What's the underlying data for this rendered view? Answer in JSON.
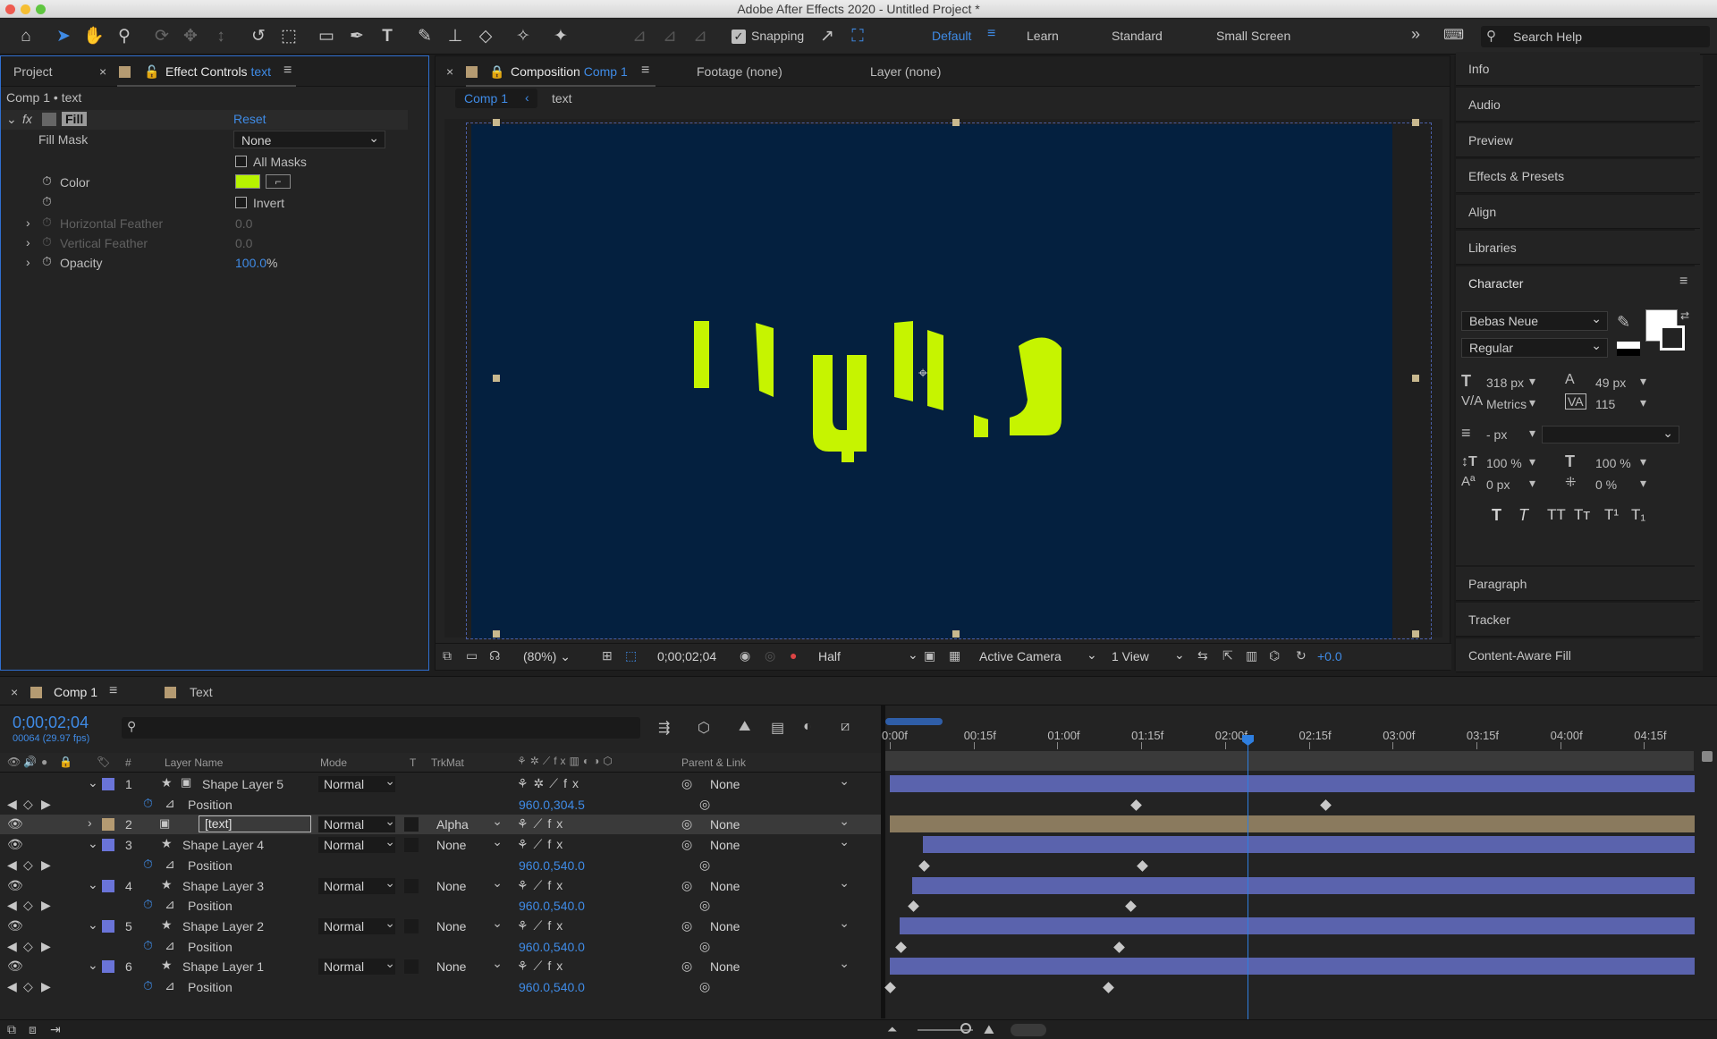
{
  "app": {
    "title": "Adobe After Effects 2020 - Untitled Project *"
  },
  "toolbar": {
    "snapping_label": "Snapping",
    "workspaces": [
      "Default",
      "Learn",
      "Standard",
      "Small Screen"
    ],
    "search_placeholder": "Search Help"
  },
  "effect_controls": {
    "tabs": {
      "project": "Project",
      "effect_controls": "Effect Controls",
      "effect_target": "text"
    },
    "breadcrumb": "Comp 1 • text",
    "effect_name": "Fill",
    "reset_label": "Reset",
    "fill_mask_label": "Fill Mask",
    "fill_mask_value": "None",
    "all_masks_label": "All Masks",
    "color_label": "Color",
    "color_value": "#b7f200",
    "invert_label": "Invert",
    "h_feather_label": "Horizontal Feather",
    "h_feather_value": "0.0",
    "v_feather_label": "Vertical Feather",
    "v_feather_value": "0.0",
    "opacity_label": "Opacity",
    "opacity_value": "100.0",
    "opacity_unit": "%"
  },
  "composition": {
    "tabs": {
      "composition": "Composition",
      "comp_name": "Comp 1",
      "footage": "Footage (none)",
      "layer": "Layer (none)"
    },
    "breadcrumb": [
      "Comp 1",
      "text"
    ],
    "background_color": "#04203f",
    "text_color": "#c6f400",
    "footer": {
      "zoom": "(80%)",
      "timecode": "0;00;02;04",
      "resolution": "Half",
      "camera": "Active Camera",
      "views": "1 View",
      "exposure": "+0.0"
    }
  },
  "right_panels": {
    "items_top": [
      "Info",
      "Audio",
      "Preview",
      "Effects & Presets",
      "Align",
      "Libraries"
    ],
    "character": {
      "title": "Character",
      "font": "Bebas Neue",
      "style": "Regular",
      "size": "318 px",
      "leading": "49 px",
      "kerning": "Metrics",
      "tracking": "115",
      "stroke": "- px",
      "v_scale": "100 %",
      "h_scale": "100 %",
      "baseline": "0 px",
      "tsume": "0 %"
    },
    "items_bottom": [
      "Paragraph",
      "Tracker",
      "Content-Aware Fill"
    ]
  },
  "timeline": {
    "tabs": [
      "Comp 1",
      "Text"
    ],
    "timecode": "0;00;02;04",
    "frames": "00064 (29.97 fps)",
    "headers": {
      "num": "#",
      "layer_name": "Layer Name",
      "mode": "Mode",
      "t": "T",
      "trkmat": "TrkMat",
      "parent": "Parent & Link"
    },
    "ruler": [
      "0:00f",
      "00:15f",
      "01:00f",
      "01:15f",
      "02:00f",
      "02:15f",
      "03:00f",
      "03:15f",
      "04:00f",
      "04:15f"
    ],
    "layers": [
      {
        "num": "1",
        "name": "Shape Layer 5",
        "mode": "Normal",
        "trkmat": "",
        "parent": "None",
        "prop": "Position",
        "value": "960.0,304.5"
      },
      {
        "num": "2",
        "name": "[text]",
        "mode": "Normal",
        "trkmat": "Alpha",
        "parent": "None"
      },
      {
        "num": "3",
        "name": "Shape Layer 4",
        "mode": "Normal",
        "trkmat": "None",
        "parent": "None",
        "prop": "Position",
        "value": "960.0,540.0"
      },
      {
        "num": "4",
        "name": "Shape Layer 3",
        "mode": "Normal",
        "trkmat": "None",
        "parent": "None",
        "prop": "Position",
        "value": "960.0,540.0"
      },
      {
        "num": "5",
        "name": "Shape Layer 2",
        "mode": "Normal",
        "trkmat": "None",
        "parent": "None",
        "prop": "Position",
        "value": "960.0,540.0"
      },
      {
        "num": "6",
        "name": "Shape Layer 1",
        "mode": "Normal",
        "trkmat": "None",
        "parent": "None",
        "prop": "Position",
        "value": "960.0,540.0"
      }
    ],
    "colors": {
      "shape_label": "#6a74d8",
      "text_label": "#b59b72",
      "bar": "#5a63ad",
      "text_bar": "#8a7a5e",
      "playhead": "#2f7fe0"
    }
  }
}
